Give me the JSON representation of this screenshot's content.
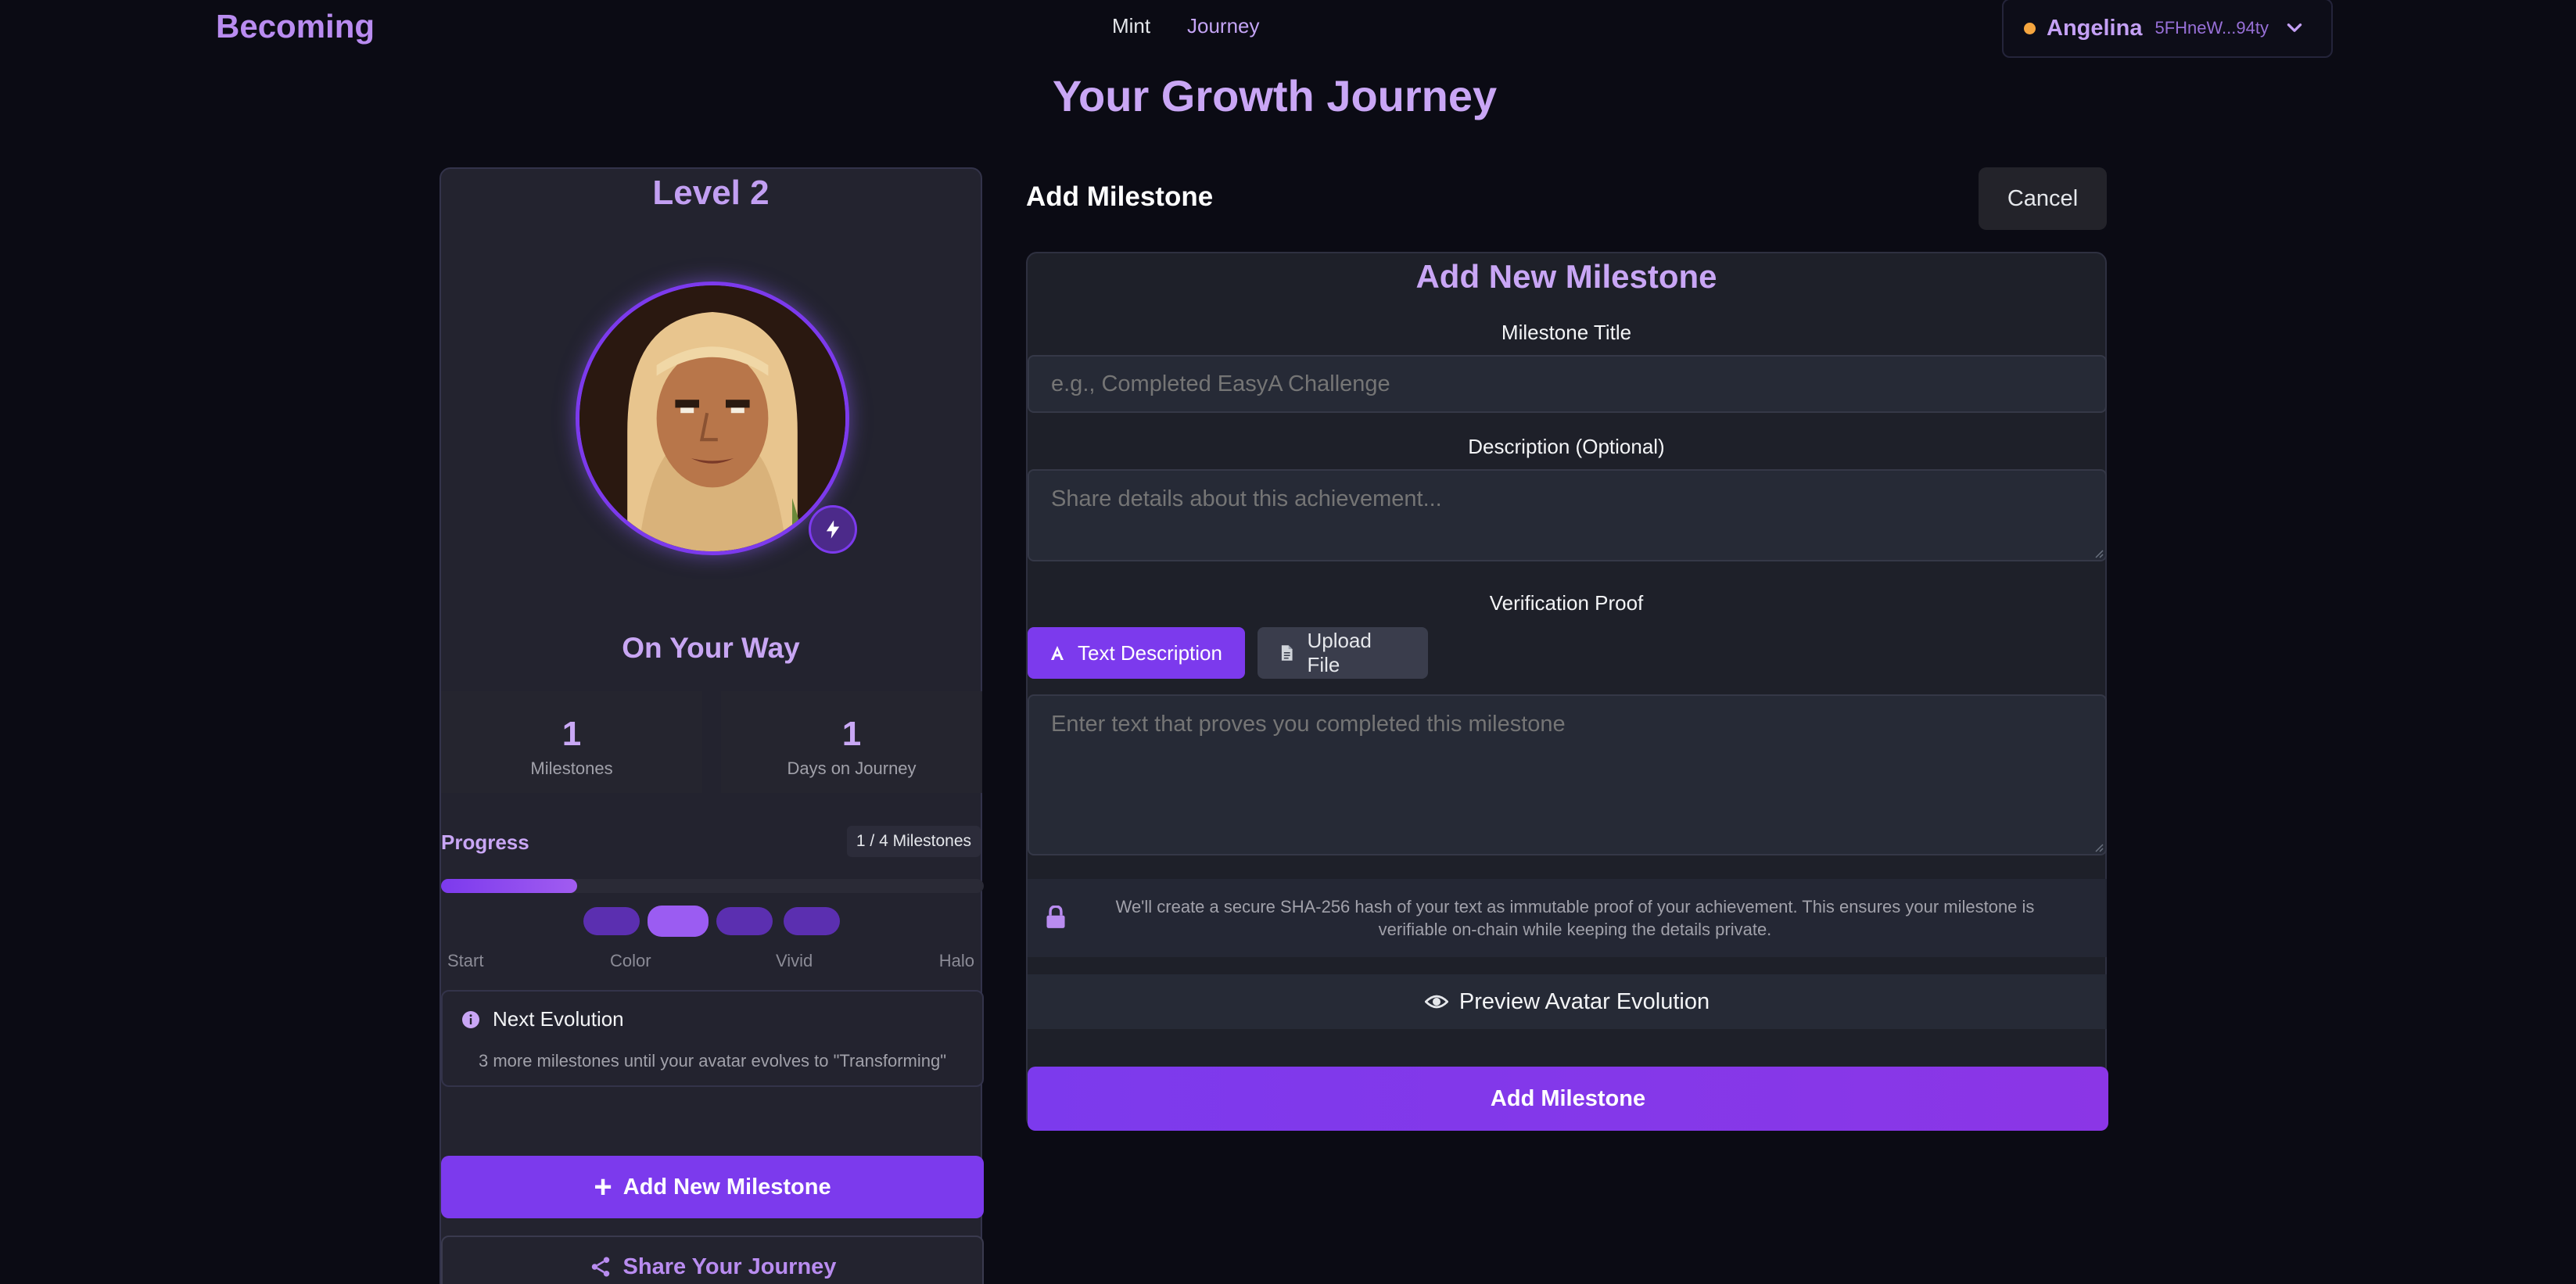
{
  "header": {
    "brand": "Becoming",
    "nav": {
      "mint": "Mint",
      "journey": "Journey"
    },
    "wallet": {
      "name": "Angelina",
      "address": "5FHneW...94ty",
      "status_color": "#f5a53f"
    }
  },
  "page_title": "Your Growth Journey",
  "profile": {
    "level": "Level 2",
    "status": "On Your Way",
    "stats": [
      {
        "value": "1",
        "label": "Milestones"
      },
      {
        "value": "1",
        "label": "Days on Journey"
      }
    ],
    "progress": {
      "label": "Progress",
      "count_text": "1 / 4 Milestones",
      "fraction": 0.25,
      "stages": [
        "Start",
        "Color",
        "Vivid",
        "Halo"
      ]
    },
    "next_evolution": {
      "title": "Next Evolution",
      "description": "3 more milestones until your avatar evolves to \"Transforming\""
    },
    "add_button": "Add New Milestone",
    "share_button": "Share Your Journey"
  },
  "panel": {
    "heading": "Add Milestone",
    "cancel": "Cancel"
  },
  "form": {
    "title": "Add New Milestone",
    "title_label": "Milestone Title",
    "title_placeholder": "e.g., Completed EasyA Challenge",
    "description_label": "Description (Optional)",
    "description_placeholder": "Share details about this achievement...",
    "proof_label": "Verification Proof",
    "proof_tabs": {
      "text": "Text Description",
      "file": "Upload File"
    },
    "proof_placeholder": "Enter text that proves you completed this milestone",
    "security_note": "We'll create a secure SHA-256 hash of your text as immutable proof of your achievement. This ensures your milestone is verifiable on-chain while keeping the details private.",
    "preview": "Preview Avatar Evolution",
    "submit": "Add Milestone"
  },
  "colors": {
    "accent": "#7c3aed",
    "accent_text": "#c9a6f5",
    "background": "#0b0b14"
  }
}
